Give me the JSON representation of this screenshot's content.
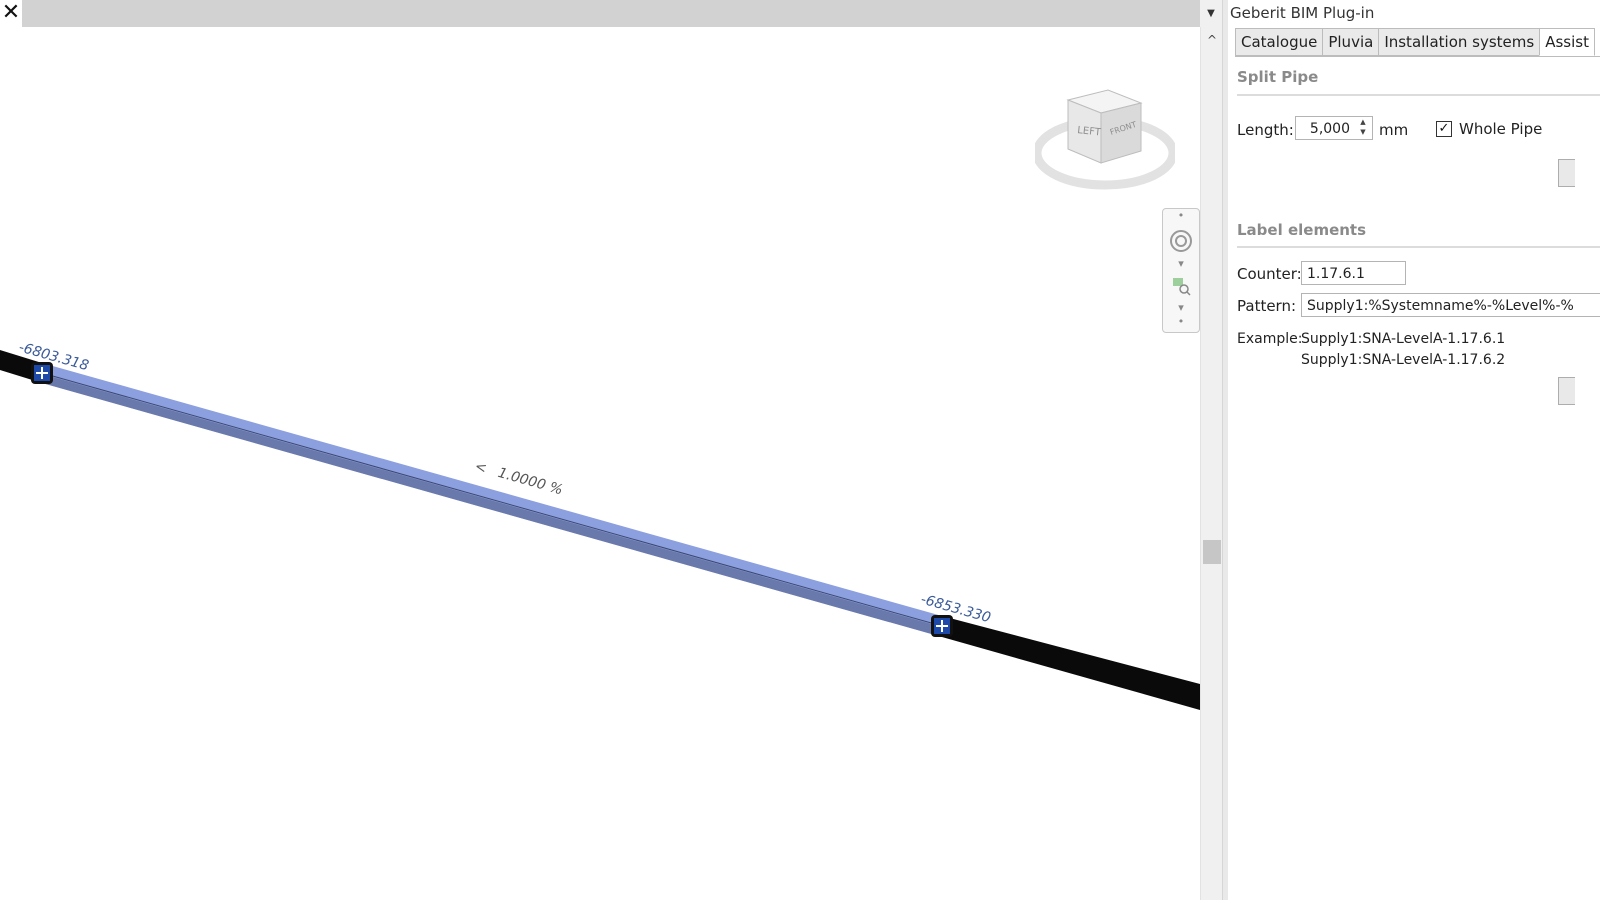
{
  "viewport": {
    "close_glyph": "✕",
    "viewcube": {
      "left": "LEFT",
      "front": "FRONT"
    },
    "pipe": {
      "start_elevation": "-6803.318",
      "end_elevation": "-6853.330",
      "slope_symbol": "<",
      "slope_value": "1.0000 %"
    }
  },
  "scrollbar": {
    "collapse_glyph": "▼",
    "up_glyph": "^"
  },
  "panel": {
    "title": "Geberit BIM Plug-in",
    "tabs": [
      {
        "label": "Catalogue",
        "active": false
      },
      {
        "label": "Pluvia",
        "active": false
      },
      {
        "label": "Installation systems",
        "active": false
      },
      {
        "label": "Assist",
        "active": true
      }
    ],
    "split_pipe": {
      "title": "Split Pipe",
      "length_label": "Length:",
      "length_value": "5,000",
      "length_unit": "mm",
      "whole_pipe_label": "Whole Pipe",
      "whole_pipe_checked": true
    },
    "label_elements": {
      "title": "Label elements",
      "counter_label": "Counter:",
      "counter_value": "1.17.6.1",
      "pattern_label": "Pattern:",
      "pattern_value": "Supply1:%Systemname%-%Level%-%",
      "example_label": "Example:",
      "example_line1": "Supply1:SNA-LevelA-1.17.6.1",
      "example_line2": "Supply1:SNA-LevelA-1.17.6.2"
    }
  },
  "colors": {
    "pipe_highlight": "#8c9fdf",
    "pipe_black": "#0a0a0a",
    "dimension_text": "#3a5a98",
    "grip": "#1d49a8"
  }
}
